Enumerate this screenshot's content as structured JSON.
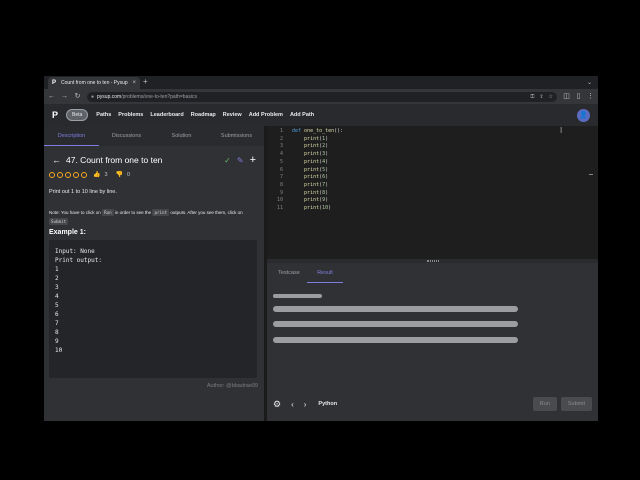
{
  "browser": {
    "tab_title": "Count from one to ten - Pysup",
    "tab_favicon": "P",
    "tab_close": "×",
    "new_tab": "+",
    "url_host": "pysup.com",
    "url_path": "/problems/one-to-ten?path=basics"
  },
  "site": {
    "logo": "P",
    "beta": "Beta",
    "nav": [
      "Paths",
      "Problems",
      "Leaderboard",
      "Roadmap",
      "Review",
      "Add Problem",
      "Add Path"
    ]
  },
  "left_tabs": [
    "Description",
    "Discussions",
    "Solution",
    "Submissions"
  ],
  "problem": {
    "title": "47. Count from one to ten",
    "likes": "3",
    "dislikes": "0",
    "description": "Print out 1 to 10 line by line.",
    "note_prefix": "Note: You have to click on",
    "note_run": "Run",
    "note_mid": "in order to see the",
    "note_print": "print",
    "note_suffix": "outputs. After you see them, click on",
    "note_submit": "Submit",
    "example_heading": "Example 1:",
    "example_lines": [
      "Input: None",
      "Print output:",
      "1",
      "2",
      "3",
      "4",
      "5",
      "6",
      "7",
      "8",
      "9",
      "10"
    ],
    "author": "Author: @bbadrae99"
  },
  "editor": {
    "lines": [
      {
        "n": "1",
        "code": "def one_to_ten():"
      },
      {
        "n": "2",
        "code": "    print(1)"
      },
      {
        "n": "3",
        "code": "    print(2)"
      },
      {
        "n": "4",
        "code": "    print(3)"
      },
      {
        "n": "5",
        "code": "    print(4)"
      },
      {
        "n": "6",
        "code": "    print(5)"
      },
      {
        "n": "7",
        "code": "    print(6)"
      },
      {
        "n": "8",
        "code": "    print(7)"
      },
      {
        "n": "9",
        "code": "    print(8)"
      },
      {
        "n": "10",
        "code": "    print(9)"
      },
      {
        "n": "11",
        "code": "    print(10)"
      }
    ]
  },
  "console": {
    "tabs": [
      "Testcase",
      "Result"
    ],
    "active_tab": "Result",
    "language": "Python",
    "run": "Run",
    "submit": "Submit"
  }
}
